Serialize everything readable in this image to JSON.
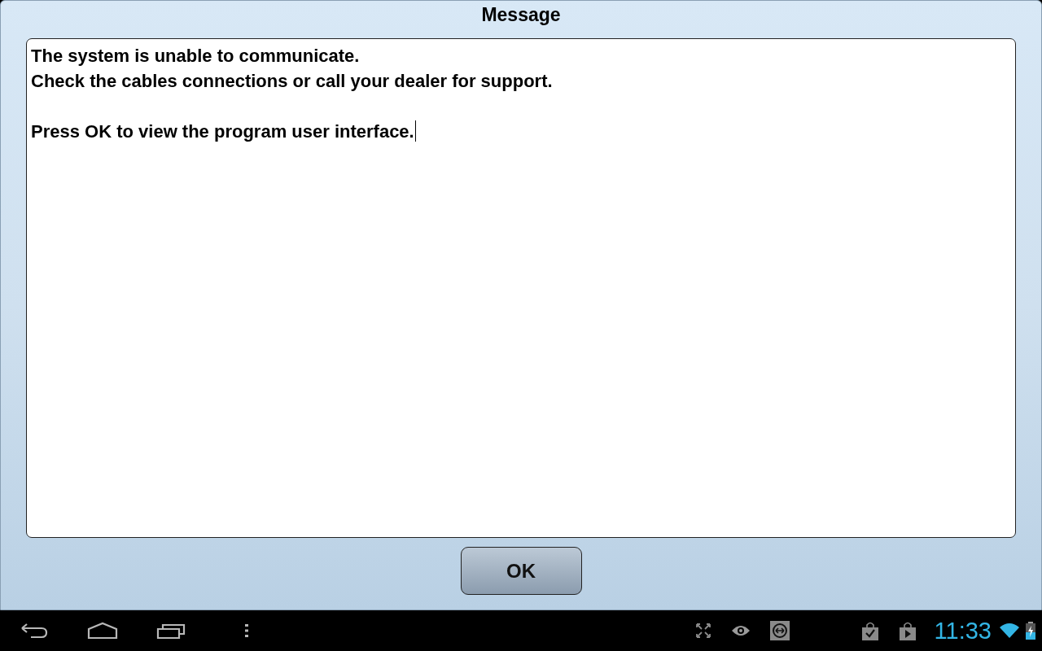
{
  "dialog": {
    "title": "Message",
    "message": {
      "paragraphs": [
        [
          "The system is unable to communicate.",
          "Check the cables connections or call your dealer for support."
        ],
        [
          "Press OK to view the program user interface."
        ]
      ],
      "text_cursor": true
    },
    "buttons": [
      "OK"
    ]
  },
  "system_bar": {
    "clock": "11:33"
  }
}
